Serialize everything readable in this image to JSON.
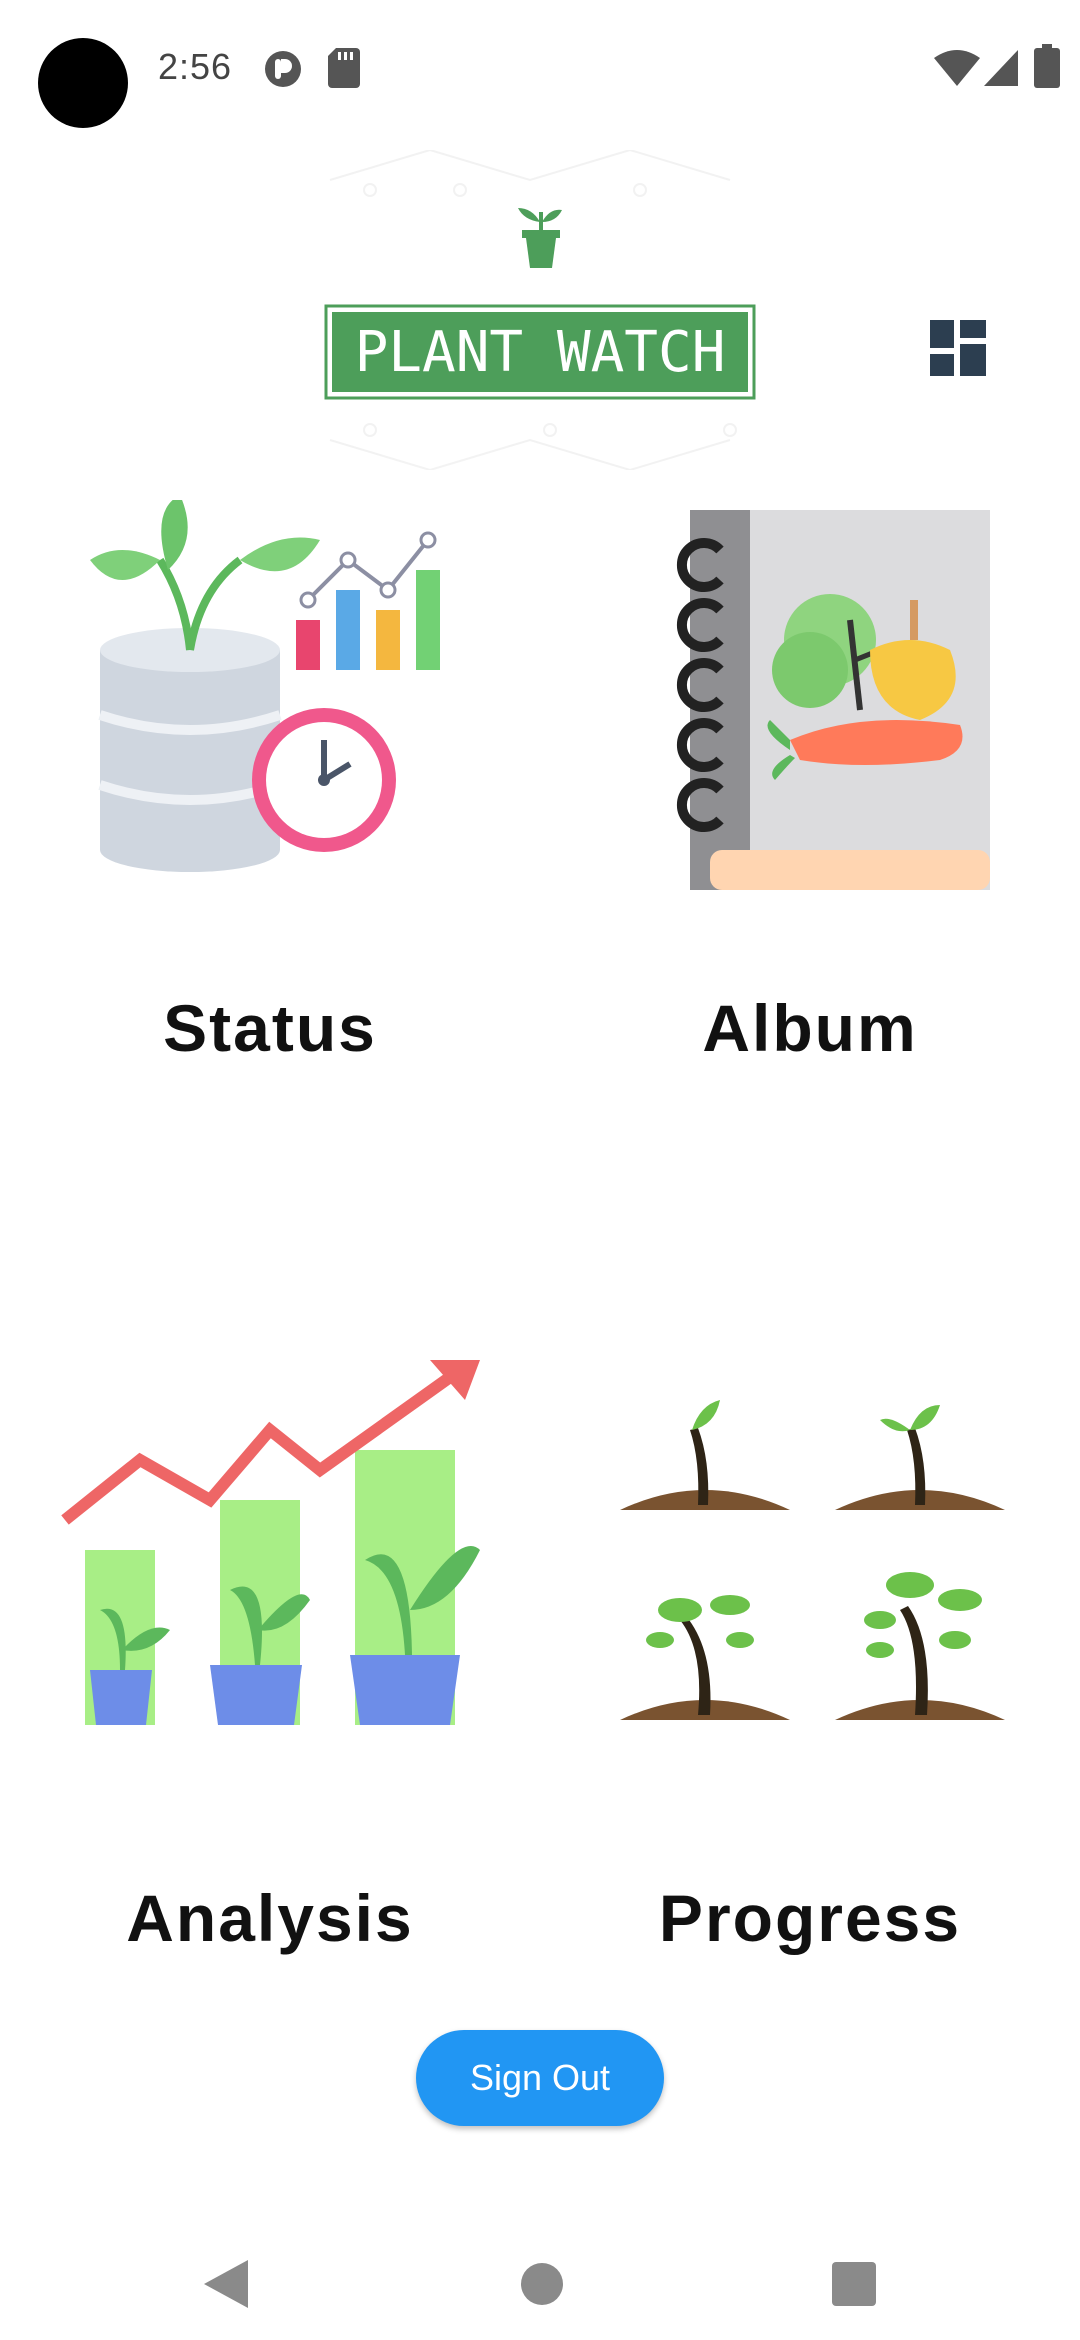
{
  "status_bar": {
    "time": "2:56",
    "icons": [
      "camera-cutout",
      "notification-app-icon",
      "sd-card-icon",
      "wifi-icon",
      "signal-icon",
      "battery-icon"
    ]
  },
  "header": {
    "logo_text": "PLANT WATCH",
    "logo_color": "#4d9e5a",
    "menu_icon": "dashboard-icon"
  },
  "tiles": [
    {
      "label": "Status",
      "icon": "plant-database-clock-icon"
    },
    {
      "label": "Album",
      "icon": "vegetable-notebook-icon"
    },
    {
      "label": "Analysis",
      "icon": "growth-chart-plants-icon"
    },
    {
      "label": "Progress",
      "icon": "seedling-stages-icon"
    }
  ],
  "signout": {
    "label": "Sign Out",
    "color": "#2196f3"
  },
  "nav_bar": {
    "items": [
      "back-icon",
      "home-icon",
      "recents-icon"
    ]
  }
}
